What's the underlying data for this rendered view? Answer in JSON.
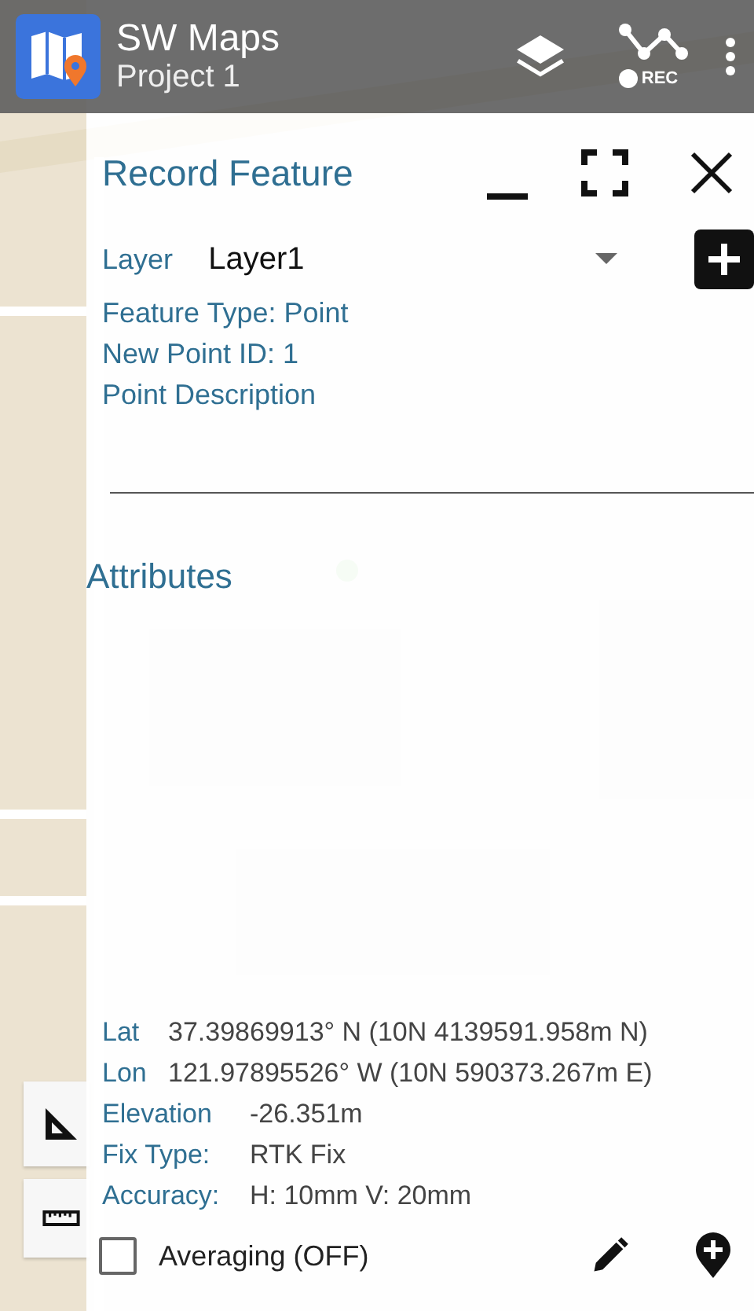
{
  "app_bar": {
    "title": "SW Maps",
    "subtitle": "Project 1",
    "rec_label": "REC"
  },
  "panel": {
    "title": "Record Feature",
    "layer_label": "Layer",
    "layer_value": "Layer1",
    "info": [
      "Feature Type: Point",
      "New Point ID: 1",
      "Point Description"
    ],
    "section": "Attributes",
    "readings": [
      {
        "label": "Lat",
        "value": "37.39869913° N (10N 4139591.958m N)"
      },
      {
        "label": "Lon",
        "value": "121.97895526° W (10N 590373.267m E)"
      },
      {
        "label": "Elevation",
        "value": "-26.351m"
      },
      {
        "label": "Fix Type:",
        "value": "RTK Fix"
      },
      {
        "label": "Accuracy:",
        "value": "H: 10mm V: 20mm"
      }
    ],
    "averaging": {
      "label": "Averaging (OFF)",
      "checked": false
    }
  }
}
